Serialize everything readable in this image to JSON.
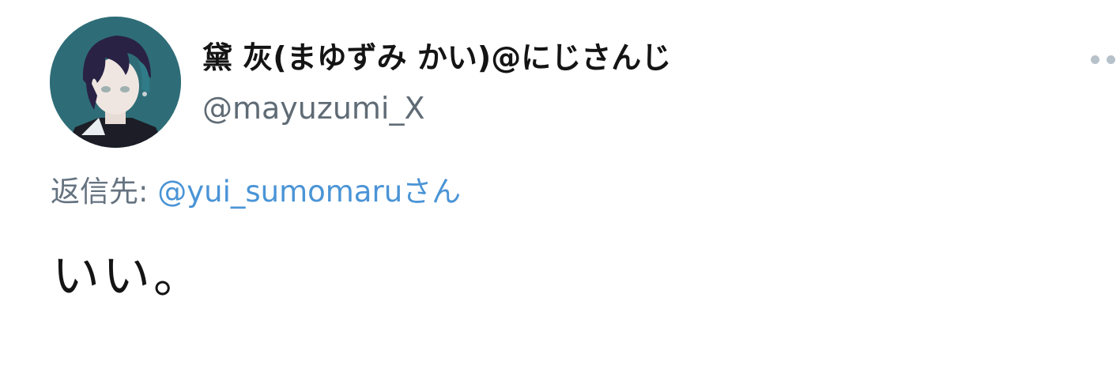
{
  "author": {
    "display_name": "黛 灰(まゆずみ かい)@にじさんじ",
    "handle": "@mayuzumi_X",
    "avatar_icon": "character-avatar"
  },
  "more_icon": "more-options-icon",
  "reply": {
    "prefix": "返信先: ",
    "target": "@yui_sumomaru",
    "suffix": "さん"
  },
  "tweet": {
    "text": "いい。"
  },
  "colors": {
    "link": "#4a94d6",
    "secondary_text": "#657380",
    "primary_text": "#141414",
    "more_dots": "#b6c1ca"
  }
}
